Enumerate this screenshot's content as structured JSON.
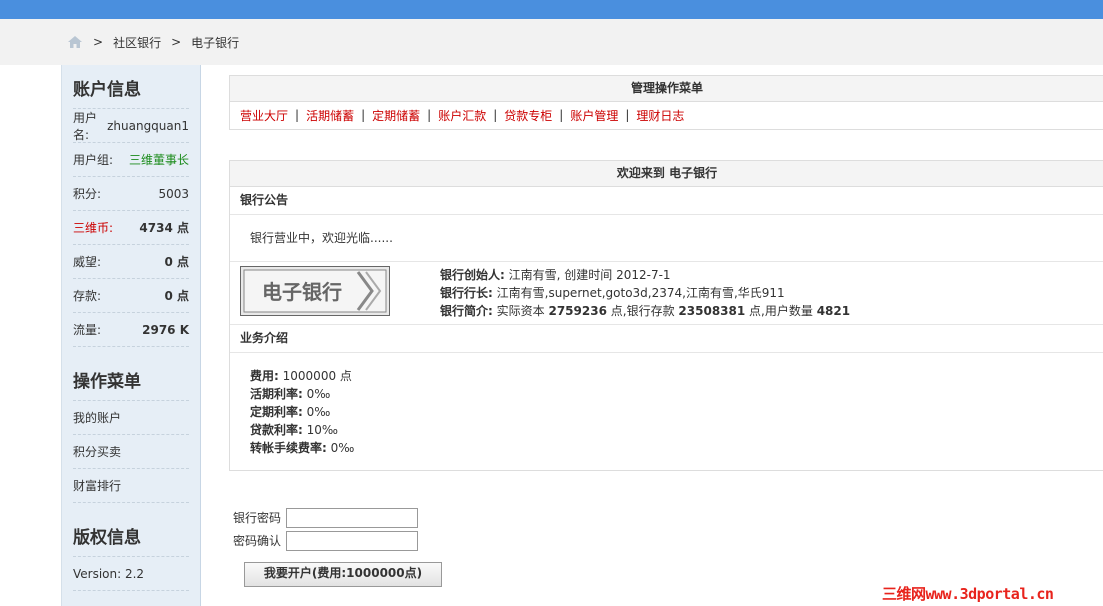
{
  "breadcrumb": {
    "items": [
      "社区银行",
      "电子银行"
    ],
    "separator": ">"
  },
  "sidebar": {
    "account_title": "账户信息",
    "account_rows": [
      {
        "label": "用户名:",
        "value": "zhuangquan1"
      },
      {
        "label": "用户组:",
        "value": "三维董事长"
      },
      {
        "label": "积分:",
        "value": "5003"
      },
      {
        "label": "三维币:",
        "value": "4734 点"
      },
      {
        "label": "威望:",
        "value": "0 点"
      },
      {
        "label": "存款:",
        "value": "0 点"
      },
      {
        "label": "流量:",
        "value": "2976 K"
      }
    ],
    "ops_title": "操作菜单",
    "ops_items": [
      "我的账户",
      "积分买卖",
      "财富排行"
    ],
    "copyright_title": "版权信息",
    "version": "Version: 2.2"
  },
  "menu_panel": {
    "title": "管理操作菜单",
    "items": [
      "营业大厅",
      "活期储蓄",
      "定期储蓄",
      "账户汇款",
      "贷款专柜",
      "账户管理",
      "理财日志"
    ]
  },
  "welcome_panel": {
    "title": "欢迎来到 电子银行",
    "notice_title": "银行公告",
    "notice_text": "银行营业中，欢迎光临......",
    "logo_text": "电子银行",
    "founder_label": "银行创始人:",
    "founder_value": "江南有雪, 创建时间 2012-7-1",
    "managers_label": "银行行长:",
    "managers_value": "江南有雪,supernet,goto3d,2374,江南有雪,华氏911",
    "intro_label": "银行简介:",
    "intro_pre": "实际资本",
    "capital": "2759236",
    "intro_mid1": "点,银行存款",
    "deposits": "23508381",
    "intro_mid2": "点,用户数量",
    "users": "4821",
    "business_title": "业务介绍",
    "fees": [
      {
        "label": "费用:",
        "value": "1000000 点"
      },
      {
        "label": "活期利率:",
        "value": "0‰"
      },
      {
        "label": "定期利率:",
        "value": "0‰"
      },
      {
        "label": "贷款利率:",
        "value": "10‰"
      },
      {
        "label": "转帐手续费率:",
        "value": "0‰"
      }
    ]
  },
  "form": {
    "password_label": "银行密码",
    "confirm_label": "密码确认",
    "password_value": "",
    "confirm_value": "",
    "submit_label": "我要开户(费用:1000000点)"
  },
  "watermark": "三维网www.3dportal.cn",
  "colors": {
    "topbar": "#4a8fde",
    "link_red": "#cc0000",
    "group_green": "#1a8b1a",
    "sidebar_bg": "#e6eef6"
  },
  "icons": {
    "home": "home-icon"
  }
}
